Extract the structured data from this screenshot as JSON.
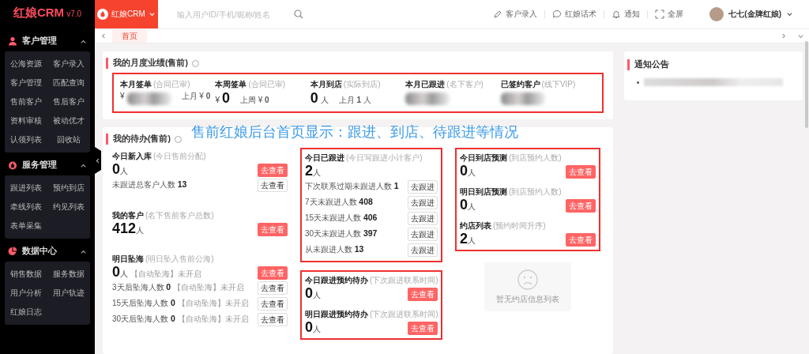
{
  "sidebar": {
    "brand": "红娘CRM",
    "version": "v7.0",
    "groups": [
      {
        "title": "客户管理",
        "expanded": true,
        "items": [
          "公海资源",
          "客户录入",
          "客户管理",
          "匹配查询",
          "售前客户",
          "售后客户",
          "资料审核",
          "被动优才",
          "认领列表",
          "回收站"
        ]
      },
      {
        "title": "服务管理",
        "expanded": true,
        "items": [
          "跟进列表",
          "预约到店",
          "牵线列表",
          "约见列表",
          "表单采集"
        ]
      },
      {
        "title": "数据中心",
        "expanded": true,
        "items": [
          "销售数据",
          "服务数据",
          "用户分析",
          "用户轨迹",
          "红娘日志"
        ]
      }
    ]
  },
  "topbar": {
    "app_menu": "红娘CRM",
    "search": {
      "placeholder": "输入用户ID/手机/昵称/姓名"
    },
    "actions": [
      {
        "label": "客户录入"
      },
      {
        "label": "红娘话术"
      },
      {
        "label": "通知"
      },
      {
        "label": "全屏"
      }
    ],
    "user": "七七(金牌红娘)"
  },
  "tabs": [
    {
      "label": "首页",
      "selected": true
    }
  ],
  "annotation": "售前红娘后台首页显示：跟进、到店、待跟进等情况",
  "performance": {
    "title": "我的月度业绩(售前)",
    "metrics": [
      {
        "label": "本月签单",
        "hint": "(合同已审)",
        "currency": "¥",
        "redacted": true,
        "compare": "上月 ¥ **0**"
      },
      {
        "label": "本周签单",
        "hint": "(合同已审)",
        "currency": "¥",
        "value": "0",
        "compare": "上周 ¥ **0**"
      },
      {
        "label": "本月到店",
        "hint": "(实际到店)",
        "value": "0",
        "unit": "人",
        "compare": "上月 **1** 人"
      },
      {
        "label": "本月已跟进",
        "hint": "(名下客户)",
        "redacted": true
      },
      {
        "label": "已签约客户",
        "hint": "(线下VIP)",
        "redacted": true
      }
    ]
  },
  "todo": {
    "title": "我的待办(售前)",
    "columns": [
      {
        "blocks": [
          {
            "title": "今日新入库",
            "hint": "(今日售前分配)",
            "value": "0",
            "unit": "人",
            "button": "去查看",
            "rows": [
              {
                "text": "未跟进总客户人数 **13**",
                "button": "去查看"
              }
            ]
          },
          {
            "title": "我的客户",
            "hint": "(名下售前客户总数)",
            "value": "412",
            "unit": "人",
            "button": "去查看"
          },
          {
            "title": "明日坠海",
            "hint": "(明日坠入售前公海)",
            "value": "0",
            "unit": "人",
            "note": "【自动坠海】未开启",
            "button": "去查看",
            "rows": [
              {
                "text": "3天后坠海人数 **0**",
                "note": "【自动坠海】未开启",
                "button": "去查看"
              },
              {
                "text": "15天后坠海人数 **0**",
                "note": "【自动坠海】未开启",
                "button": "去查看"
              },
              {
                "text": "30天后坠海人数 **0**",
                "note": "【自动坠海】未开启",
                "button": "去查看"
              }
            ]
          }
        ]
      },
      {
        "groups": [
          {
            "highlighted": true,
            "blocks": [
              {
                "title": "今日已跟进",
                "hint": "(今日写跟进小计客户)",
                "value": "2",
                "unit": "人",
                "rows": [
                  {
                    "text": "下次联系过期未跟进人数 **1**",
                    "button": "去跟进"
                  },
                  {
                    "text": "7天未跟进人数 **408**",
                    "button": "去跟进"
                  },
                  {
                    "text": "15天未跟进人数 **406**",
                    "button": "去跟进"
                  },
                  {
                    "text": "30天未跟进人数 **397**",
                    "button": "去跟进"
                  },
                  {
                    "text": "从未跟进人数 **13**",
                    "button": "去跟进"
                  }
                ]
              }
            ]
          },
          {
            "highlighted": true,
            "blocks": [
              {
                "title": "今日跟进预约待办",
                "hint": "(下次跟进联系时间)",
                "value": "0",
                "unit": "人",
                "button": "去查看"
              },
              {
                "title": "明日跟进预约待办",
                "hint": "(下次跟进联系时间)",
                "value": "0",
                "unit": "人",
                "button": "去查看"
              }
            ]
          }
        ]
      },
      {
        "groups": [
          {
            "highlighted": true,
            "blocks": [
              {
                "title": "今日到店预测",
                "hint": "(到店预约人数)",
                "value": "0",
                "unit": "人",
                "button": "去查看"
              },
              {
                "title": "明日到店预测",
                "hint": "(到店预约人数)",
                "value": "0",
                "unit": "人",
                "button": "去查看"
              },
              {
                "title": "约店列表",
                "hint": "(预约时间升序)",
                "value": "2",
                "unit": "人",
                "button": "去查看"
              }
            ]
          }
        ],
        "empty": "暂无约店信息列表"
      }
    ]
  },
  "notices": {
    "title": "通知公告",
    "items": [
      {
        "kind": "redacted"
      }
    ]
  }
}
